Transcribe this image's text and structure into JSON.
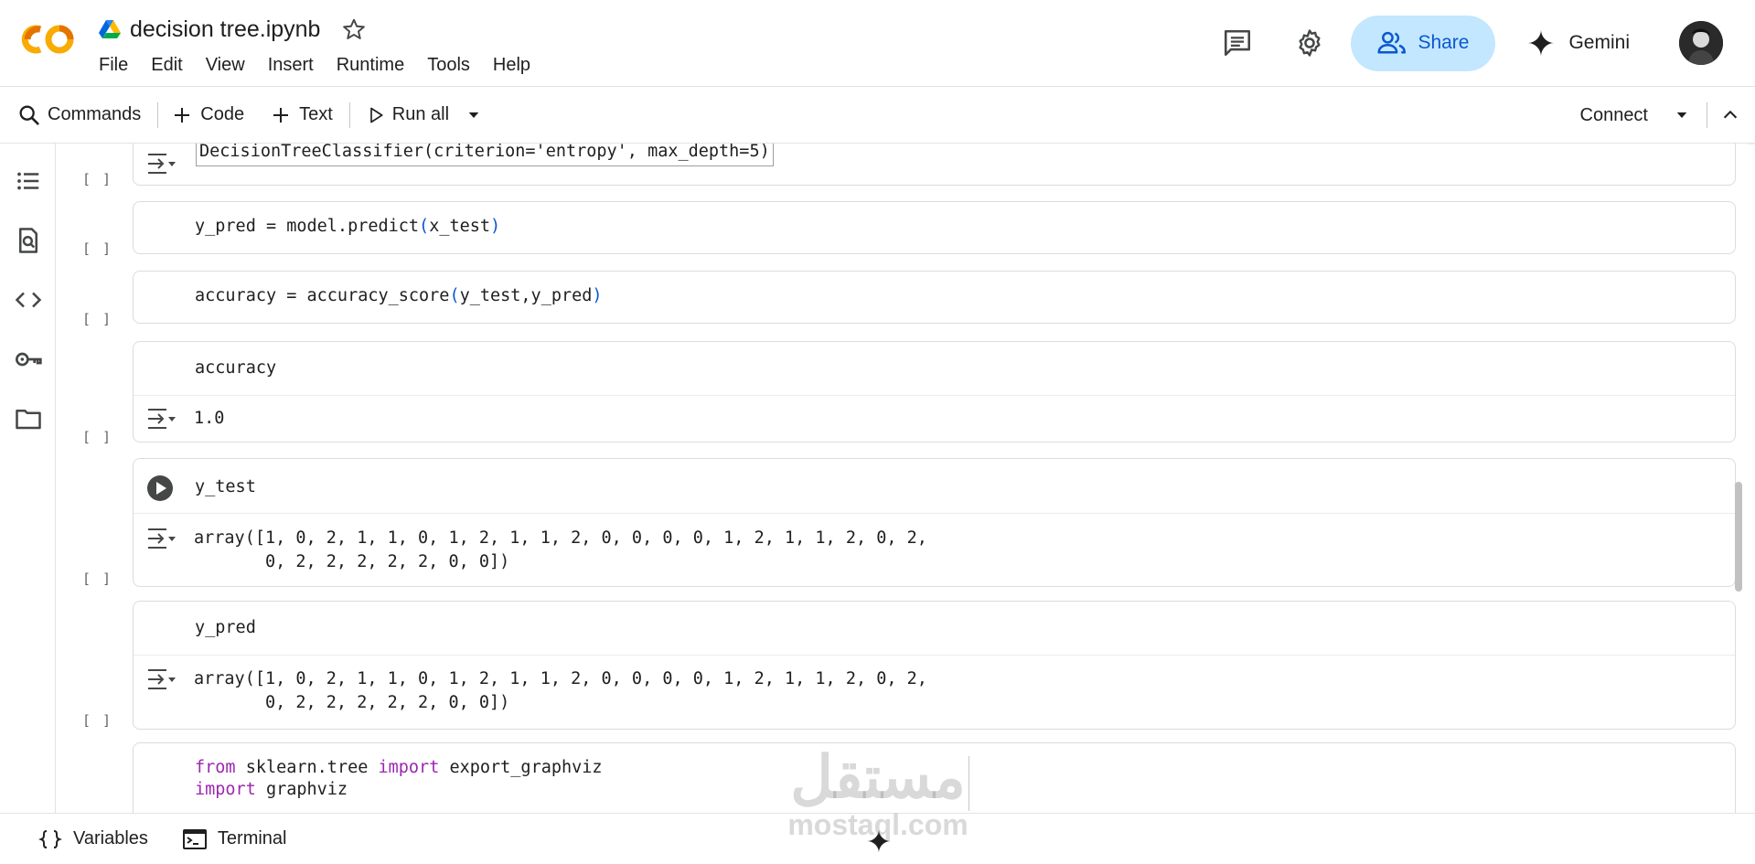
{
  "app": {
    "title": "decision tree.ipynb",
    "logo": "colab-logo",
    "accent": "#0b57d0",
    "share_bg": "#c2e7ff"
  },
  "menu": [
    "File",
    "Edit",
    "View",
    "Insert",
    "Runtime",
    "Tools",
    "Help"
  ],
  "header": {
    "share_label": "Share",
    "gemini_label": "Gemini"
  },
  "toolbar": {
    "commands_label": "Commands",
    "code_label": "Code",
    "text_label": "Text",
    "run_all_label": "Run all",
    "connect_label": "Connect"
  },
  "sidebar": {
    "items": [
      "table-of-contents-icon",
      "find-replace-icon",
      "code-snippets-icon",
      "secrets-key-icon",
      "files-folder-icon"
    ]
  },
  "cells": [
    {
      "id": "c0",
      "exec": "",
      "code": "DecisionTreeClassifier(criterion='entropy', max_depth=5)",
      "has_output": true,
      "output": ""
    },
    {
      "id": "c1",
      "exec": "[ ]",
      "code_pre": "y_pred = model.predict",
      "code_args": "x_test"
    },
    {
      "id": "c2",
      "exec": "[ ]",
      "code_pre": "accuracy = accuracy_score",
      "code_args": "y_test,y_pred"
    },
    {
      "id": "c3",
      "exec": "[ ]",
      "code": "accuracy",
      "output": "1.0"
    },
    {
      "id": "c4",
      "exec": "[ ]",
      "code": "y_test",
      "output_line1": "array([1, 0, 2, 1, 1, 0, 1, 2, 1, 1, 2, 0, 0, 0, 0, 1, 2, 1, 1, 2, 0, 2,",
      "output_line2": "       0, 2, 2, 2, 2, 2, 0, 0])"
    },
    {
      "id": "c5",
      "exec": "[ ]",
      "code": "y_pred",
      "output_line1": "array([1, 0, 2, 1, 1, 0, 1, 2, 1, 1, 2, 0, 0, 0, 0, 1, 2, 1, 1, 2, 0, 2,",
      "output_line2": "       0, 2, 2, 2, 2, 2, 0, 0])"
    },
    {
      "id": "c6",
      "exec": "[ ]",
      "line1_kw1": "from",
      "line1_mid": " sklearn.tree ",
      "line1_kw2": "import",
      "line1_end": " export_graphviz",
      "line2_kw": "import",
      "line2_end": " graphviz"
    }
  ],
  "bottom": {
    "variables_label": "Variables",
    "terminal_label": "Terminal"
  },
  "watermark": {
    "arabic": "مستقل",
    "latin": "mostaql.com"
  }
}
